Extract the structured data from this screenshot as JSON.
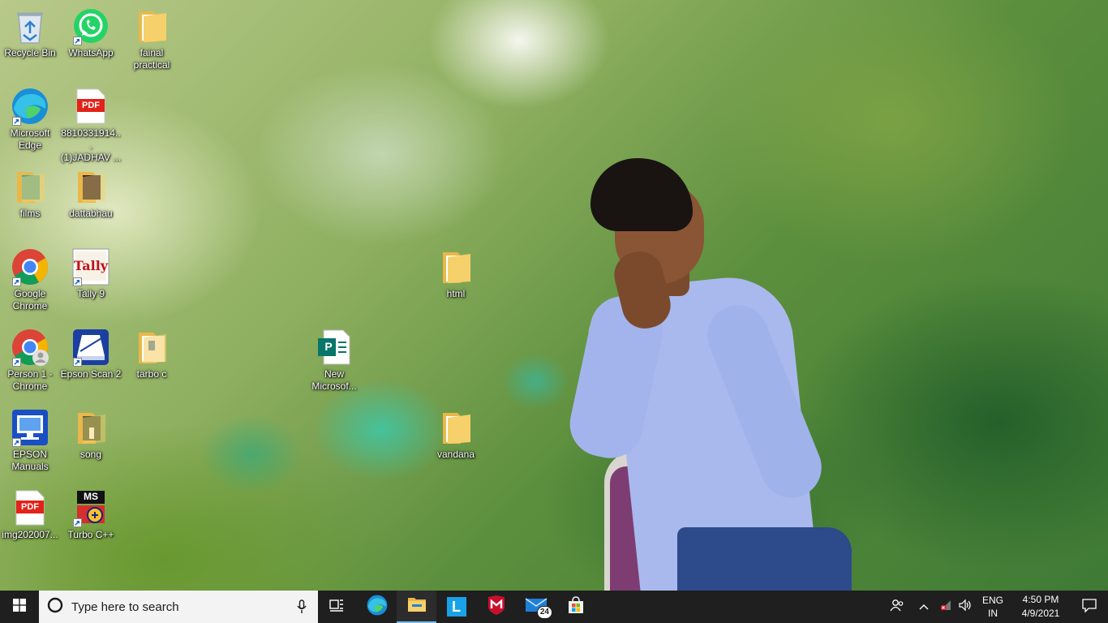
{
  "desktop": {
    "icons": [
      {
        "label": "Recycle Bin",
        "icon": "recycle-bin-icon"
      },
      {
        "label": "WhatsApp",
        "icon": "whatsapp-icon"
      },
      {
        "label": "fainal practical",
        "icon": "folder-icon"
      },
      {
        "label": "Microsoft Edge",
        "icon": "edge-icon"
      },
      {
        "label": "8810331914...\n(1)JADHAV ...",
        "icon": "pdf-icon",
        "badge": "PDF"
      },
      {
        "label": "films",
        "icon": "folder-icon"
      },
      {
        "label": "dattabhau",
        "icon": "folder-icon"
      },
      {
        "label": "Google Chrome",
        "icon": "chrome-icon"
      },
      {
        "label": "Tally 9",
        "icon": "tally-icon",
        "badge": "Tally"
      },
      {
        "label": "html",
        "icon": "folder-icon"
      },
      {
        "label": "Person 1 - Chrome",
        "icon": "chrome-person-icon"
      },
      {
        "label": "Epson Scan 2",
        "icon": "epson-scan-icon"
      },
      {
        "label": "tarbo c",
        "icon": "folder-icon"
      },
      {
        "label": "New Microsof...",
        "icon": "publisher-icon",
        "badge": "P"
      },
      {
        "label": "EPSON Manuals",
        "icon": "epson-manuals-icon"
      },
      {
        "label": "song",
        "icon": "folder-icon"
      },
      {
        "label": "vandana",
        "icon": "folder-icon"
      },
      {
        "label": "img202007...",
        "icon": "pdf-icon",
        "badge": "PDF"
      },
      {
        "label": "Turbo C++",
        "icon": "turbo-cpp-icon",
        "badge": "MS"
      }
    ]
  },
  "taskbar": {
    "search_placeholder": "Type here to search",
    "pinned": [
      {
        "name": "task-view",
        "icon": "task-view-icon"
      },
      {
        "name": "edge",
        "icon": "edge-icon"
      },
      {
        "name": "file-explorer",
        "icon": "folder-icon"
      },
      {
        "name": "l-app",
        "icon": "l-app-icon",
        "letter": "L"
      },
      {
        "name": "mcafee",
        "icon": "mcafee-icon"
      },
      {
        "name": "mail",
        "icon": "mail-icon",
        "badge": "24"
      },
      {
        "name": "store",
        "icon": "store-icon"
      }
    ],
    "tray": {
      "lang_top": "ENG",
      "lang_bottom": "IN",
      "time": "4:50 PM",
      "date": "4/9/2021"
    }
  },
  "colors": {
    "taskbar": "#1f1f1f",
    "folder": "#f4c95d",
    "accent": "#0078d7"
  }
}
